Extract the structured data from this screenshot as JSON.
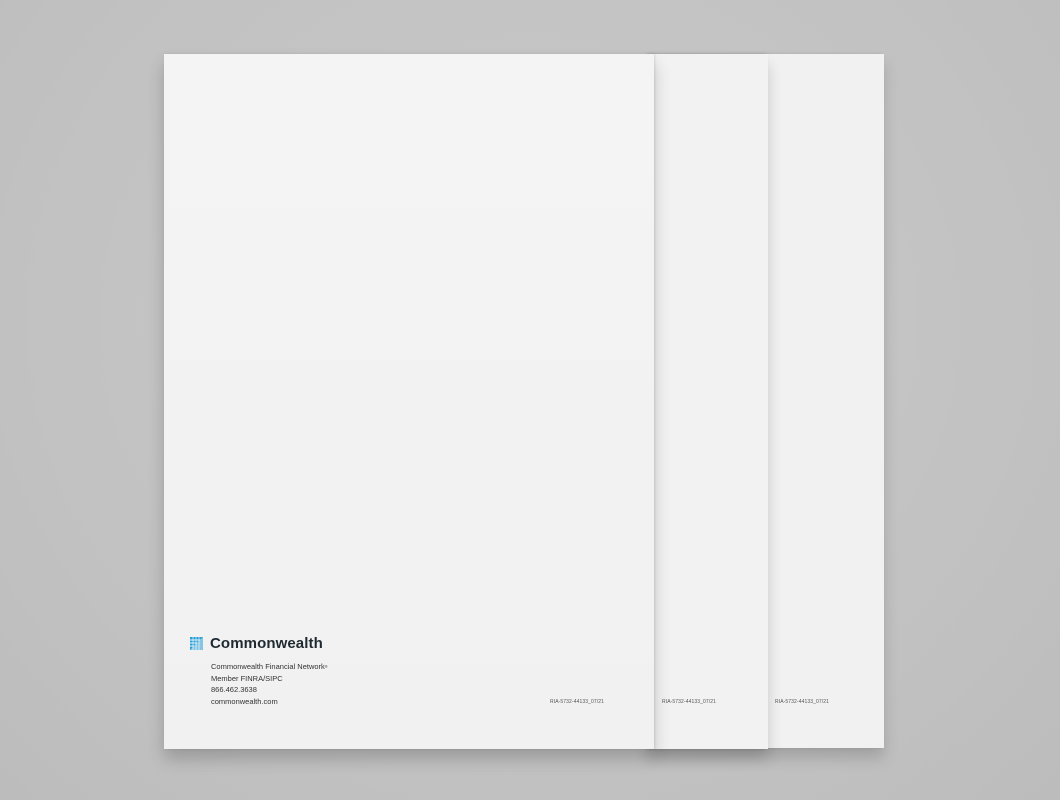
{
  "scene": {
    "background_color": "#c4c4c4",
    "paper_color": "#f3f3f3"
  },
  "brand": {
    "logo_icon": "commonwealth-logo-icon",
    "logo_color": "#2a9fd6",
    "name": "Commonwealth"
  },
  "contact": {
    "company": "Commonwealth Financial Network",
    "registered_mark": "®",
    "membership": "Member FINRA/SIPC",
    "phone": "866.462.3638",
    "website": "commonwealth.com"
  },
  "booklets": [
    {
      "code": "RIA-5732-44133_07/21"
    },
    {
      "code": "RIA-5732-44133_07/21"
    },
    {
      "code": "RIA-5732-44133_07/21"
    }
  ]
}
